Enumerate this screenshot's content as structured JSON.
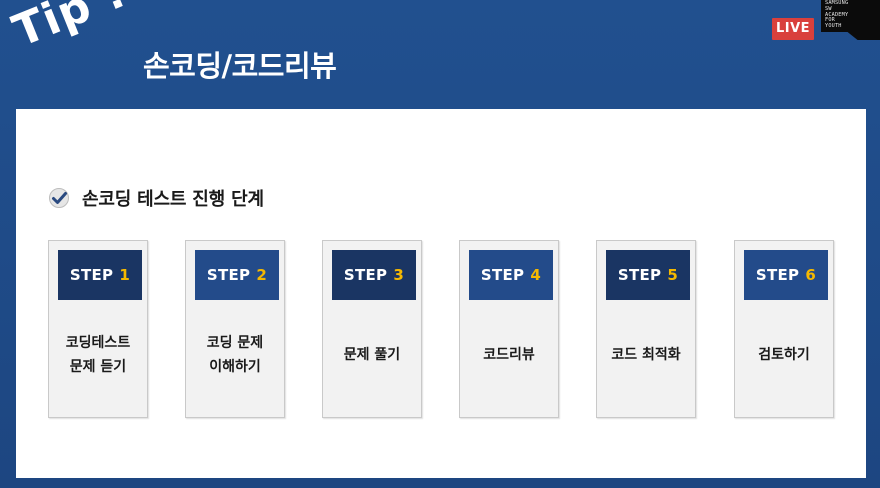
{
  "header": {
    "tip_label": "Tip !",
    "title": "손코딩/코드리뷰",
    "live_badge": "LIVE",
    "logo_lines": [
      "SAMSUNG",
      "SW",
      "ACADEMY",
      "FOR",
      "YOUTH"
    ]
  },
  "section": {
    "heading": "손코딩 테스트 진행 단계",
    "icon": "check-icon"
  },
  "steps": [
    {
      "label": "STEP",
      "number": "1",
      "desc": "코딩테스트\n문제 듣기",
      "shade": "dark"
    },
    {
      "label": "STEP",
      "number": "2",
      "desc": "코딩 문제\n이해하기",
      "shade": "mid"
    },
    {
      "label": "STEP",
      "number": "3",
      "desc": "문제 풀기",
      "shade": "dark"
    },
    {
      "label": "STEP",
      "number": "4",
      "desc": "코드리뷰",
      "shade": "mid"
    },
    {
      "label": "STEP",
      "number": "5",
      "desc": "코드 최적화",
      "shade": "dark"
    },
    {
      "label": "STEP",
      "number": "6",
      "desc": "검토하기",
      "shade": "mid"
    }
  ],
  "colors": {
    "background": "#1f4a86",
    "live_badge": "#d9403c",
    "step_dark": "#1a3563",
    "step_mid": "#234b8a",
    "step_number": "#f5b800"
  }
}
